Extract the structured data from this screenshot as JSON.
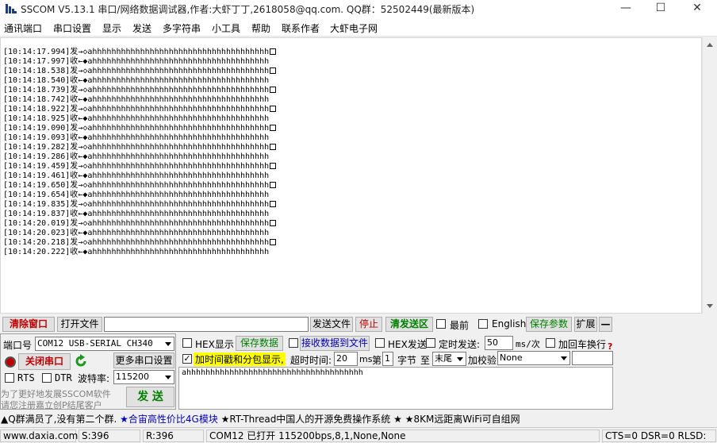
{
  "window": {
    "title": "SSCOM V5.13.1 串口/网络数据调试器,作者:大虾丁丁,2618058@qq.com. QQ群：52502449(最新版本)",
    "minimize": "—",
    "maximize": "☐",
    "close": "✕"
  },
  "menu": [
    "通讯端口",
    "串口设置",
    "显示",
    "发送",
    "多字符串",
    "小工具",
    "帮助",
    "联系作者",
    "大虾电子网"
  ],
  "receive": {
    "lines": [
      {
        "ts": "[10:14:17.994]",
        "dir": "发→◇",
        "text": "ahhhhhhhhhhhhhhhhhhhhhhhhhhhhhhhhhhhhh",
        "end": true
      },
      {
        "ts": "[10:14:17.997]",
        "dir": "收←◆",
        "text": "ahhhhhhhhhhhhhhhhhhhhhhhhhhhhhhhhhhhhh",
        "end": false
      },
      {
        "ts": "[10:14:18.538]",
        "dir": "发→◇",
        "text": "ahhhhhhhhhhhhhhhhhhhhhhhhhhhhhhhhhhhhh",
        "end": true
      },
      {
        "ts": "[10:14:18.540]",
        "dir": "收←◆",
        "text": "ahhhhhhhhhhhhhhhhhhhhhhhhhhhhhhhhhhhhh",
        "end": false
      },
      {
        "ts": "[10:14:18.739]",
        "dir": "发→◇",
        "text": "ahhhhhhhhhhhhhhhhhhhhhhhhhhhhhhhhhhhhh",
        "end": true
      },
      {
        "ts": "[10:14:18.742]",
        "dir": "收←◆",
        "text": "ahhhhhhhhhhhhhhhhhhhhhhhhhhhhhhhhhhhhh",
        "end": false
      },
      {
        "ts": "[10:14:18.922]",
        "dir": "发→◇",
        "text": "ahhhhhhhhhhhhhhhhhhhhhhhhhhhhhhhhhhhhh",
        "end": true
      },
      {
        "ts": "[10:14:18.925]",
        "dir": "收←◆",
        "text": "ahhhhhhhhhhhhhhhhhhhhhhhhhhhhhhhhhhhhh",
        "end": false
      },
      {
        "ts": "[10:14:19.090]",
        "dir": "发→◇",
        "text": "ahhhhhhhhhhhhhhhhhhhhhhhhhhhhhhhhhhhhh",
        "end": true
      },
      {
        "ts": "[10:14:19.093]",
        "dir": "收←◆",
        "text": "ahhhhhhhhhhhhhhhhhhhhhhhhhhhhhhhhhhhhh",
        "end": false
      },
      {
        "ts": "[10:14:19.282]",
        "dir": "发→◇",
        "text": "ahhhhhhhhhhhhhhhhhhhhhhhhhhhhhhhhhhhhh",
        "end": true
      },
      {
        "ts": "[10:14:19.286]",
        "dir": "收←◆",
        "text": "ahhhhhhhhhhhhhhhhhhhhhhhhhhhhhhhhhhhhh",
        "end": false
      },
      {
        "ts": "[10:14:19.459]",
        "dir": "发→◇",
        "text": "ahhhhhhhhhhhhhhhhhhhhhhhhhhhhhhhhhhhhh",
        "end": true
      },
      {
        "ts": "[10:14:19.461]",
        "dir": "收←◆",
        "text": "ahhhhhhhhhhhhhhhhhhhhhhhhhhhhhhhhhhhhh",
        "end": false
      },
      {
        "ts": "[10:14:19.650]",
        "dir": "发→◇",
        "text": "ahhhhhhhhhhhhhhhhhhhhhhhhhhhhhhhhhhhhh",
        "end": true
      },
      {
        "ts": "[10:14:19.654]",
        "dir": "收←◆",
        "text": "ahhhhhhhhhhhhhhhhhhhhhhhhhhhhhhhhhhhhh",
        "end": false
      },
      {
        "ts": "[10:14:19.835]",
        "dir": "发→◇",
        "text": "ahhhhhhhhhhhhhhhhhhhhhhhhhhhhhhhhhhhhh",
        "end": true
      },
      {
        "ts": "[10:14:19.837]",
        "dir": "收←◆",
        "text": "ahhhhhhhhhhhhhhhhhhhhhhhhhhhhhhhhhhhhh",
        "end": false
      },
      {
        "ts": "[10:14:20.019]",
        "dir": "发→◇",
        "text": "ahhhhhhhhhhhhhhhhhhhhhhhhhhhhhhhhhhhhh",
        "end": true
      },
      {
        "ts": "[10:14:20.023]",
        "dir": "收←◆",
        "text": "ahhhhhhhhhhhhhhhhhhhhhhhhhhhhhhhhhhhhh",
        "end": false
      },
      {
        "ts": "[10:14:20.218]",
        "dir": "发→◇",
        "text": "ahhhhhhhhhhhhhhhhhhhhhhhhhhhhhhhhhhhhh",
        "end": true
      },
      {
        "ts": "[10:14:20.222]",
        "dir": "收←◆",
        "text": "ahhhhhhhhhhhhhhhhhhhhhhhhhhhhhhhhhhhhh",
        "end": false
      }
    ]
  },
  "toolbar": {
    "clear_window": "清除窗口",
    "open_file": "打开文件",
    "file_path": "",
    "send_file": "发送文件",
    "stop": "停止",
    "clear_send": "清发送区",
    "topmost": "最前",
    "english": "English",
    "save_params": "保存参数",
    "expand": "扩展",
    "collapse": "—"
  },
  "port": {
    "port_label": "端口号",
    "port_value": "COM12 USB-SERIAL CH340",
    "close_port": "关闭串口",
    "more_settings": "更多串口设置",
    "rts": "RTS",
    "dtr": "DTR",
    "baud_label": "波特率:",
    "baud_value": "115200",
    "promo_line1": "为了更好地发展SSCOM软件",
    "promo_line2": "请您注册嘉立创P结尾客户",
    "send": "发  送"
  },
  "options": {
    "hex_display": "HEX显示",
    "save_data": "保存数据",
    "recv_to_file": "接收数据到文件",
    "hex_send": "HEX发送",
    "timed_send": "定时发送:",
    "timed_value": "50",
    "timed_unit": "ms/次",
    "crlf": "加回车换行",
    "timestamp": "加时间戳和分包显示,",
    "timeout_label": "超时时间:",
    "timeout_value": "20",
    "timeout_unit": "ms",
    "nth_label": "第",
    "nth_value": "1",
    "byte_label": "字节",
    "to_label": "至",
    "to_value": "末尾",
    "checksum_label": "加校验",
    "checksum_value": "None",
    "send_text": "ahhhhhhhhhhhhhhhhhhhhhhhhhhhhhhhhhhhhh"
  },
  "ticker": "▲Q群满员了,没有第二个群. ★合宙高性价比4G模块 ★RT-Thread中国人的开源免费操作系统 ★ ★8KM远距离WiFi可自组网",
  "ticker_parts": [
    {
      "text": "▲Q群满员了,没有第二个群.",
      "color": "#000000"
    },
    {
      "text": "★合宙高性价比4G模块",
      "color": "#0000c0"
    },
    {
      "text": "★RT-Thread中国人的开源免费操作系统",
      "color": "#000000"
    },
    {
      "text": "★",
      "color": "#000000"
    },
    {
      "text": "★8KM远距离WiFi可自组网",
      "color": "#000000"
    }
  ],
  "status": {
    "site": "www.daxia.com",
    "sent": "S:396",
    "recv": "R:396",
    "port_state": "COM12 已打开  115200bps,8,1,None,None",
    "signals": "CTS=0 DSR=0 RLSD:"
  },
  "colors": {
    "accent_green": "#008000",
    "accent_red": "#c00000",
    "highlight_yellow": "#ffff00",
    "link_blue": "#0000c0"
  }
}
